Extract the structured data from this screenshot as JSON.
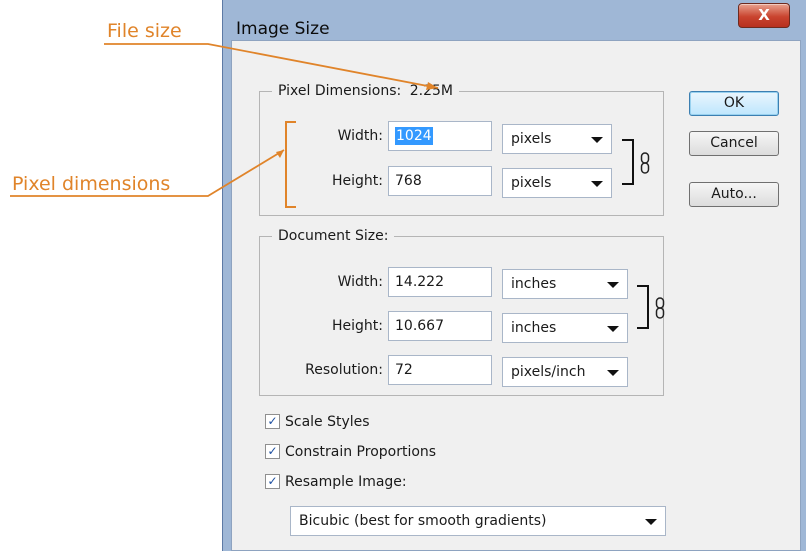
{
  "annotations": {
    "file_size_label": "File size",
    "pixel_dimensions_label": "Pixel dimensions"
  },
  "dialog": {
    "title": "Image Size",
    "close_label": "X",
    "buttons": {
      "ok": "OK",
      "cancel": "Cancel",
      "auto": "Auto..."
    },
    "pixel_dimensions": {
      "legend": "Pixel Dimensions:",
      "file_size": "2.25M",
      "width_label": "Width:",
      "width_value": "1024",
      "width_unit": "pixels",
      "height_label": "Height:",
      "height_value": "768",
      "height_unit": "pixels"
    },
    "document_size": {
      "legend": "Document Size:",
      "width_label": "Width:",
      "width_value": "14.222",
      "width_unit": "inches",
      "height_label": "Height:",
      "height_value": "10.667",
      "height_unit": "inches",
      "resolution_label": "Resolution:",
      "resolution_value": "72",
      "resolution_unit": "pixels/inch"
    },
    "options": {
      "scale_styles": {
        "label": "Scale Styles",
        "checked": true
      },
      "constrain_proportions": {
        "label": "Constrain Proportions",
        "checked": true
      },
      "resample_image": {
        "label": "Resample Image:",
        "checked": true
      }
    },
    "resample_method": "Bicubic (best for smooth gradients)"
  },
  "colors": {
    "annotation": "#e0842a",
    "window_frame": "#9fb7d6",
    "close_button": "#c9442f",
    "selection": "#3399ff"
  }
}
